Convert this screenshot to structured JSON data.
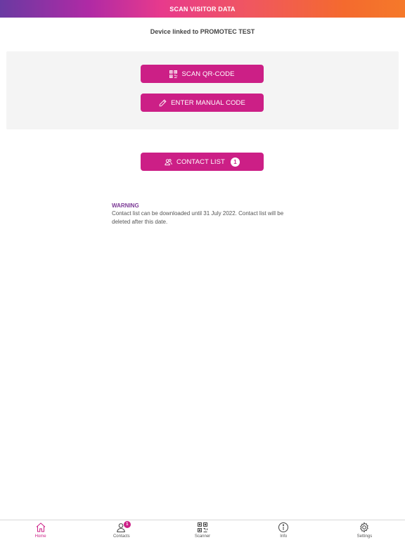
{
  "header": {
    "title": "SCAN VISITOR DATA"
  },
  "device": {
    "text": "Device linked to PROMOTEC TEST"
  },
  "actions": {
    "scan_label": "SCAN QR-CODE",
    "manual_label": "ENTER MANUAL CODE",
    "contacts_label": "CONTACT LIST",
    "contacts_count": "1"
  },
  "warning": {
    "title": "WARNING",
    "text": "Contact list can be downloaded until 31 July 2022. Contact list will be deleted after this date."
  },
  "tabbar": {
    "items": [
      {
        "label": "Home",
        "icon": "home-icon",
        "active": true
      },
      {
        "label": "Contacts",
        "icon": "user-icon",
        "badge": "1"
      },
      {
        "label": "Scanner",
        "icon": "qr-icon"
      },
      {
        "label": "Info",
        "icon": "info-icon"
      },
      {
        "label": "Settings",
        "icon": "gear-icon"
      }
    ]
  },
  "colors": {
    "accent": "#cc1f86",
    "warning_title": "#7c3a96",
    "panel": "#f4f4f4"
  }
}
